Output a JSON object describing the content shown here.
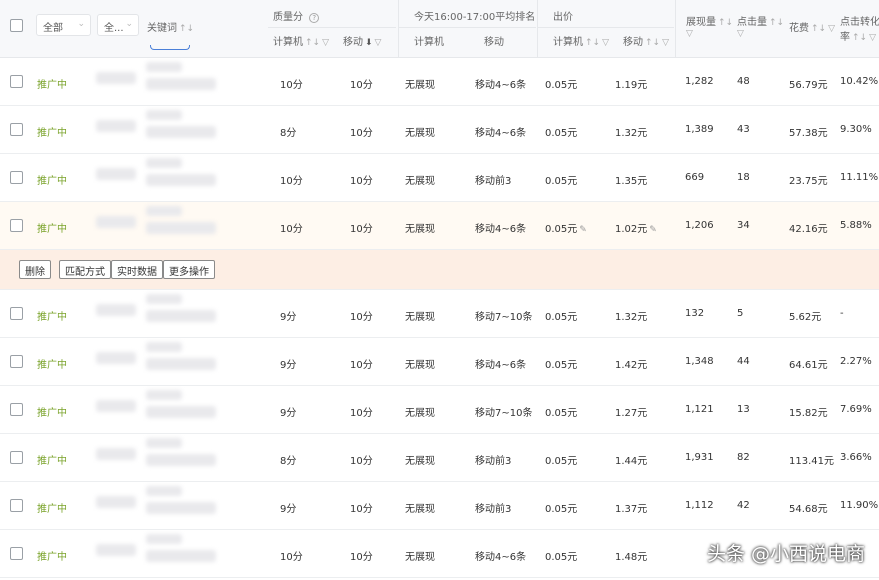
{
  "header": {
    "filter_all": "全部",
    "filter_all2": "全...",
    "keyword": "关键词",
    "quality": "质量分",
    "quality_help": "?",
    "rank_group": "今天16:00-17:00平均排名",
    "bid_group": "出价",
    "pc": "计算机",
    "mobile": "移动",
    "impressions": "展现量",
    "clicks": "点击量",
    "spend": "花费",
    "conv_rate_l1": "点击转化",
    "conv_rate_l2": "率"
  },
  "rows": [
    {
      "status": "推广中",
      "q_pc": "10分",
      "q_mob": "10分",
      "rank_pc": "无展现",
      "rank_mob": "移动4~6条",
      "bid_pc": "0.05元",
      "bid_mob": "1.19元",
      "impr": "1,282",
      "clicks": "48",
      "spend": "56.79元",
      "conv": "10.42%"
    },
    {
      "status": "推广中",
      "q_pc": "8分",
      "q_mob": "10分",
      "rank_pc": "无展现",
      "rank_mob": "移动4~6条",
      "bid_pc": "0.05元",
      "bid_mob": "1.32元",
      "impr": "1,389",
      "clicks": "43",
      "spend": "57.38元",
      "conv": "9.30%"
    },
    {
      "status": "推广中",
      "q_pc": "10分",
      "q_mob": "10分",
      "rank_pc": "无展现",
      "rank_mob": "移动前3",
      "bid_pc": "0.05元",
      "bid_mob": "1.35元",
      "impr": "669",
      "clicks": "18",
      "spend": "23.75元",
      "conv": "11.11%"
    },
    {
      "status": "推广中",
      "q_pc": "10分",
      "q_mob": "10分",
      "rank_pc": "无展现",
      "rank_mob": "移动4~6条",
      "bid_pc": "0.05元",
      "bid_mob": "1.02元",
      "impr": "1,206",
      "clicks": "34",
      "spend": "42.16元",
      "conv": "5.88%"
    },
    {
      "status": "推广中",
      "q_pc": "9分",
      "q_mob": "10分",
      "rank_pc": "无展现",
      "rank_mob": "移动7~10条",
      "bid_pc": "0.05元",
      "bid_mob": "1.32元",
      "impr": "132",
      "clicks": "5",
      "spend": "5.62元",
      "conv": "-"
    },
    {
      "status": "推广中",
      "q_pc": "9分",
      "q_mob": "10分",
      "rank_pc": "无展现",
      "rank_mob": "移动4~6条",
      "bid_pc": "0.05元",
      "bid_mob": "1.42元",
      "impr": "1,348",
      "clicks": "44",
      "spend": "64.61元",
      "conv": "2.27%"
    },
    {
      "status": "推广中",
      "q_pc": "9分",
      "q_mob": "10分",
      "rank_pc": "无展现",
      "rank_mob": "移动7~10条",
      "bid_pc": "0.05元",
      "bid_mob": "1.27元",
      "impr": "1,121",
      "clicks": "13",
      "spend": "15.82元",
      "conv": "7.69%"
    },
    {
      "status": "推广中",
      "q_pc": "8分",
      "q_mob": "10分",
      "rank_pc": "无展现",
      "rank_mob": "移动前3",
      "bid_pc": "0.05元",
      "bid_mob": "1.44元",
      "impr": "1,931",
      "clicks": "82",
      "spend": "113.41元",
      "conv": "3.66%"
    },
    {
      "status": "推广中",
      "q_pc": "9分",
      "q_mob": "10分",
      "rank_pc": "无展现",
      "rank_mob": "移动前3",
      "bid_pc": "0.05元",
      "bid_mob": "1.37元",
      "impr": "1,112",
      "clicks": "42",
      "spend": "54.68元",
      "conv": "11.90%"
    },
    {
      "status": "推广中",
      "q_pc": "10分",
      "q_mob": "10分",
      "rank_pc": "无展现",
      "rank_mob": "移动4~6条",
      "bid_pc": "0.05元",
      "bid_mob": "1.48元",
      "impr": "",
      "clicks": "",
      "spend": "",
      "conv": ""
    }
  ],
  "actions": {
    "delete": "删除",
    "match": "匹配方式",
    "realtime": "实时数据",
    "more": "更多操作"
  },
  "watermark": "头条 @小西说电商",
  "colors": {
    "status": "#7aa32a",
    "highlight_row": "#fffaf3",
    "action_bar": "#fdeee4"
  }
}
